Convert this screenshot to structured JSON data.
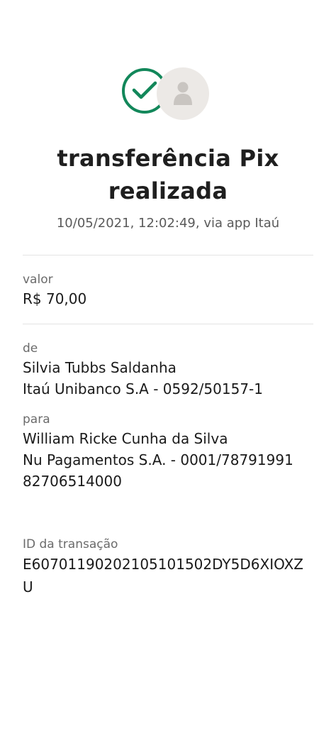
{
  "status": {
    "title_line1": "transferência Pix",
    "title_line2": "realizada",
    "datetime": "10/05/2021,  12:02:49, via app Itaú"
  },
  "valor": {
    "label": "valor",
    "amount": "R$ 70,00"
  },
  "de": {
    "label": "de",
    "name": "Silvia Tubbs Saldanha",
    "bank": "Itaú Unibanco S.A - 0592/50157-1"
  },
  "para": {
    "label": "para",
    "name": "William Ricke Cunha da Silva",
    "bank_line1": "Nu Pagamentos S.A. - 0001/78791991",
    "bank_line2": "82706514000"
  },
  "transacao": {
    "label": "ID da transação",
    "id": "E60701190202105101502DY5D6XIOXZU"
  },
  "colors": {
    "success_green": "#12875a",
    "avatar_bg": "#ece9e6",
    "avatar_fg": "#c9c5c1"
  },
  "icons": {
    "status": "check-circle-icon",
    "avatar": "user-avatar-icon"
  }
}
